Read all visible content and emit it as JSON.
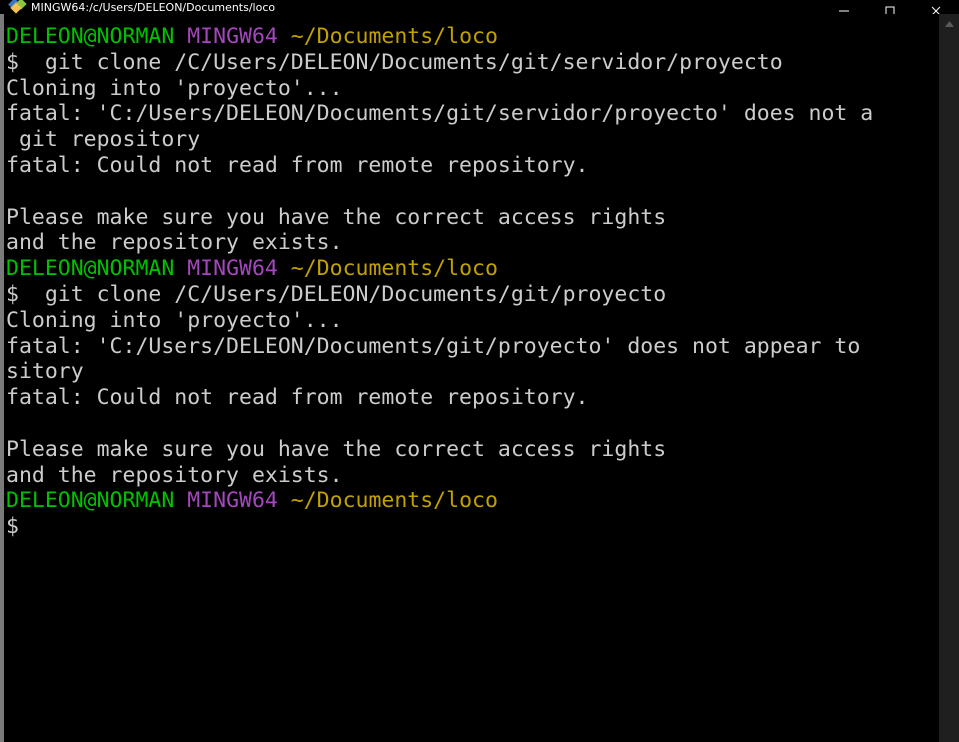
{
  "window": {
    "title": "MINGW64:/c/Users/DELEON/Documents/loco",
    "app_icon": "git-bash-icon",
    "controls": {
      "minimize_label": "Minimize",
      "maximize_label": "Maximize",
      "close_label": "Close"
    }
  },
  "colors": {
    "background": "#000000",
    "foreground": "#cccccc",
    "user_host": "#00c000",
    "mingw": "#a347ba",
    "path": "#c2a000",
    "titlebar_text": "#ffffff",
    "left_border": "#7a7a7a",
    "scrollbar": "#1f1f1f"
  },
  "terminal": {
    "prompt_user_host": "DELEON@NORMAN",
    "prompt_shell": "MINGW64",
    "prompt_path": "~/Documents/loco",
    "prompt_symbol": "$",
    "lines": [
      {
        "type": "prompt",
        "user": "DELEON@NORMAN",
        "shell": "MINGW64",
        "path": "~/Documents/loco"
      },
      {
        "type": "command",
        "text": "$  git clone /C/Users/DELEON/Documents/git/servidor/proyecto"
      },
      {
        "type": "output",
        "text": "Cloning into 'proyecto'..."
      },
      {
        "type": "output",
        "text": "fatal: 'C:/Users/DELEON/Documents/git/servidor/proyecto' does not a"
      },
      {
        "type": "output",
        "text": " git repository"
      },
      {
        "type": "output",
        "text": "fatal: Could not read from remote repository."
      },
      {
        "type": "output",
        "text": ""
      },
      {
        "type": "output",
        "text": "Please make sure you have the correct access rights"
      },
      {
        "type": "output",
        "text": "and the repository exists."
      },
      {
        "type": "prompt",
        "user": "DELEON@NORMAN",
        "shell": "MINGW64",
        "path": "~/Documents/loco"
      },
      {
        "type": "command",
        "text": "$  git clone /C/Users/DELEON/Documents/git/proyecto"
      },
      {
        "type": "output",
        "text": "Cloning into 'proyecto'..."
      },
      {
        "type": "output",
        "text": "fatal: 'C:/Users/DELEON/Documents/git/proyecto' does not appear to"
      },
      {
        "type": "output",
        "text": "sitory"
      },
      {
        "type": "output",
        "text": "fatal: Could not read from remote repository."
      },
      {
        "type": "output",
        "text": ""
      },
      {
        "type": "output",
        "text": "Please make sure you have the correct access rights"
      },
      {
        "type": "output",
        "text": "and the repository exists."
      },
      {
        "type": "prompt",
        "user": "DELEON@NORMAN",
        "shell": "MINGW64",
        "path": "~/Documents/loco"
      },
      {
        "type": "command",
        "text": "$"
      }
    ]
  },
  "scrollbar": {
    "up_arrow_icon": "triangle-up-icon"
  }
}
